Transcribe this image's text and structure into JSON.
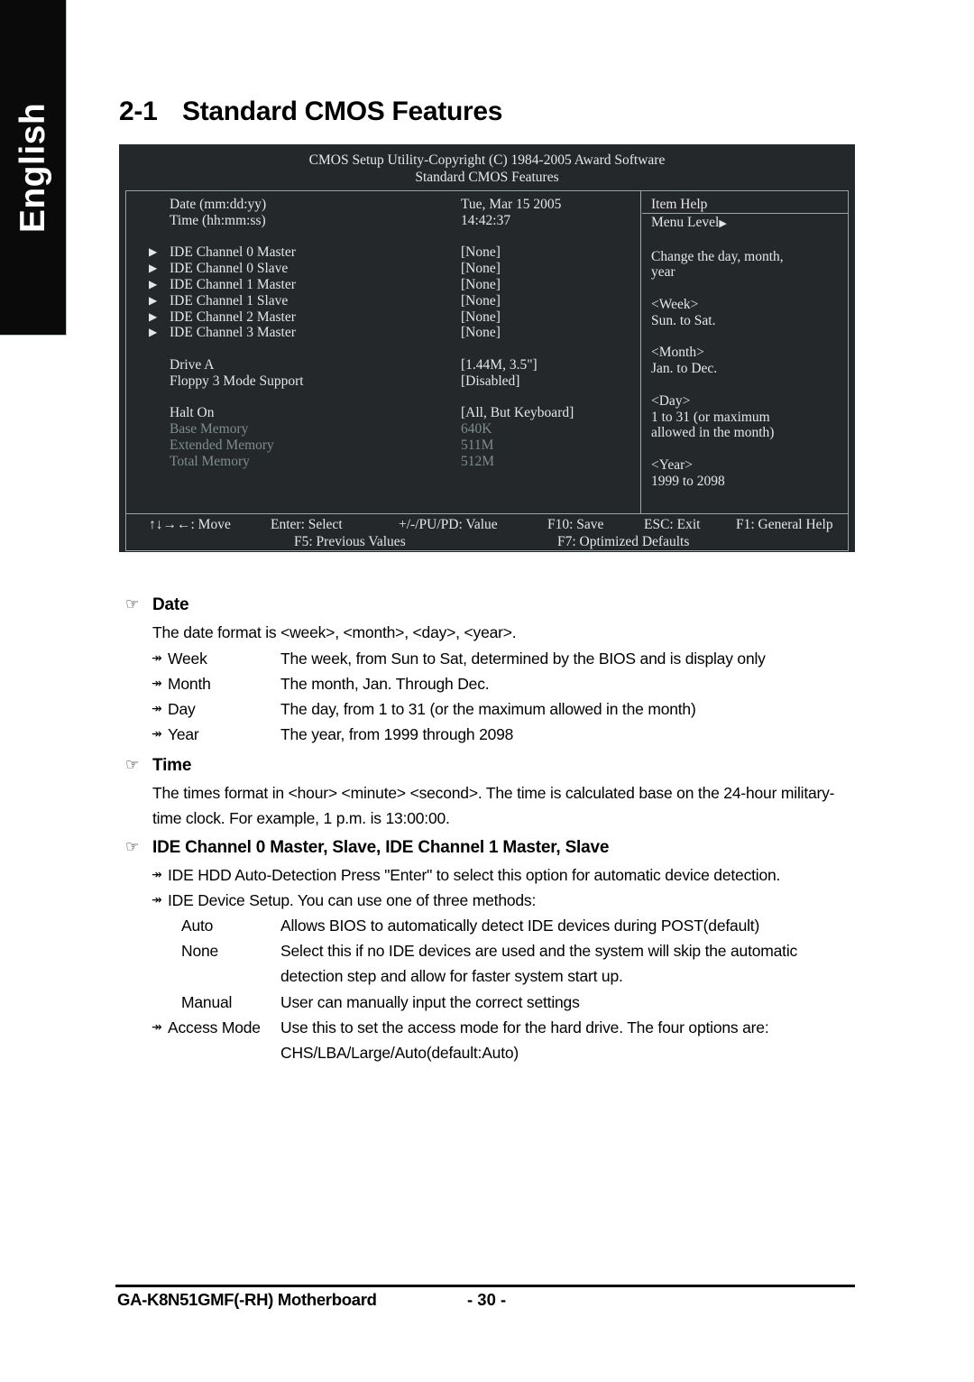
{
  "language_tab": {
    "label": "English"
  },
  "page_title": {
    "number": "2-1",
    "text": "Standard CMOS Features"
  },
  "bios": {
    "header_line1": "CMOS Setup Utility-Copyright (C) 1984-2005 Award Software",
    "header_line2": "Standard CMOS Features",
    "rows": [
      {
        "arrow": "",
        "label": "Date (mm:dd:yy)",
        "value": "Tue, Mar  15  2005",
        "dim": false
      },
      {
        "arrow": "",
        "label": "Time (hh:mm:ss)",
        "value": "14:42:37",
        "dim": false
      },
      {
        "arrow": "▶",
        "label": "IDE Channel 0 Master",
        "value": "[None]",
        "dim": false
      },
      {
        "arrow": "▶",
        "label": "IDE Channel 0 Slave",
        "value": "[None]",
        "dim": false
      },
      {
        "arrow": "▶",
        "label": "IDE Channel 1 Master",
        "value": "[None]",
        "dim": false
      },
      {
        "arrow": "▶",
        "label": "IDE Channel 1 Slave",
        "value": "[None]",
        "dim": false
      },
      {
        "arrow": "▶",
        "label": "IDE Channel 2 Master",
        "value": "[None]",
        "dim": false
      },
      {
        "arrow": "▶",
        "label": "IDE Channel 3 Master",
        "value": "[None]",
        "dim": false
      },
      {
        "arrow": "",
        "label": "Drive A",
        "value": "[1.44M, 3.5\"]",
        "dim": false
      },
      {
        "arrow": "",
        "label": "Floppy 3 Mode Support",
        "value": "[Disabled]",
        "dim": false
      },
      {
        "arrow": "",
        "label": "Halt On",
        "value": "[All, But Keyboard]",
        "dim": false
      },
      {
        "arrow": "",
        "label": "Base Memory",
        "value": "640K",
        "dim": true
      },
      {
        "arrow": "",
        "label": "Extended Memory",
        "value": "511M",
        "dim": true
      },
      {
        "arrow": "",
        "label": "Total Memory",
        "value": "512M",
        "dim": true
      }
    ],
    "item_help": {
      "title": "Item Help",
      "menu_level": "Menu Level",
      "menu_level_caret": "▶",
      "lines": [
        "Change the day, month,",
        "year",
        "",
        "<Week>",
        "Sun. to Sat.",
        "",
        "<Month>",
        "Jan. to Dec.",
        "",
        "<Day>",
        "1 to 31 (or maximum",
        "allowed in the month)",
        "",
        "<Year>",
        "1999 to 2098"
      ]
    },
    "keys": {
      "move": "↑↓→←: Move",
      "enter": "Enter: Select",
      "value": "+/-/PU/PD: Value",
      "f10": "F10: Save",
      "esc": "ESC: Exit",
      "f1": "F1: General Help",
      "f5": "F5: Previous Values",
      "f7": "F7: Optimized Defaults"
    }
  },
  "sections": {
    "date": {
      "bullet": "☞",
      "heading": "Date",
      "intro": "The date format is <week>, <month>, <day>, <year>.",
      "items": [
        {
          "marker": "↠",
          "term": "Week",
          "desc": "The week, from Sun to Sat, determined by the BIOS and is display only"
        },
        {
          "marker": "↠",
          "term": "Month",
          "desc": "The month, Jan. Through Dec."
        },
        {
          "marker": "↠",
          "term": "Day",
          "desc": "The day, from 1 to 31 (or the maximum allowed in the month)"
        },
        {
          "marker": "↠",
          "term": "Year",
          "desc": "The year, from 1999 through 2098"
        }
      ]
    },
    "time": {
      "bullet": "☞",
      "heading": "Time",
      "line1": "The times format in <hour> <minute> <second>. The time is calculated base on the 24-hour military-",
      "line2": "time clock. For example, 1 p.m. is 13:00:00."
    },
    "ide": {
      "bullet": "☞",
      "heading": "IDE Channel 0 Master, Slave, IDE Channel 1 Master, Slave",
      "auto_detection": {
        "marker": "↠",
        "text": "IDE HDD Auto-Detection Press \"Enter\" to select this option for automatic device detection."
      },
      "device_setup": {
        "marker": "↠",
        "text": "IDE Device Setup.  You can use one of three methods:"
      },
      "methods": [
        {
          "term": "Auto",
          "desc1": "Allows BIOS to automatically detect IDE devices during POST(default)",
          "desc2": ""
        },
        {
          "term": "None",
          "desc1": "Select this if no IDE devices are used and the system will skip the automatic",
          "desc2": "detection step and allow for faster system start up."
        },
        {
          "term": "Manual",
          "desc1": "User can manually input the correct settings",
          "desc2": ""
        }
      ],
      "access_mode": {
        "marker": "↠",
        "term": "Access Mode",
        "desc1": "Use this to set the access mode for the hard drive. The four options are:",
        "desc2": "CHS/LBA/Large/Auto(default:Auto)"
      }
    }
  },
  "footer": {
    "product": "GA-K8N51GMF(-RH) Motherboard",
    "page_number": "- 30 -"
  }
}
